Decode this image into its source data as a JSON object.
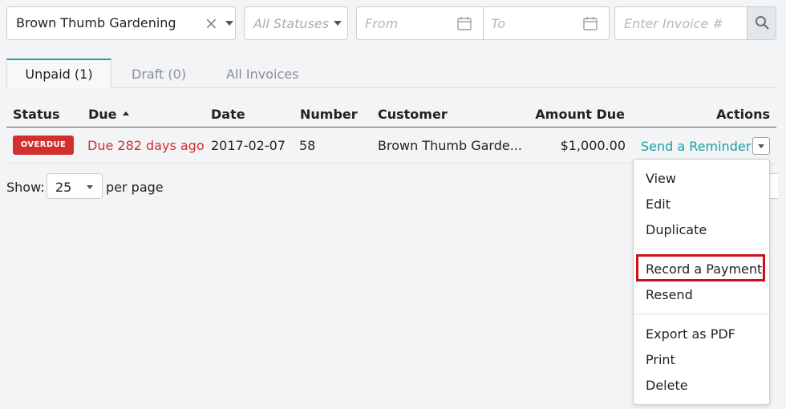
{
  "filters": {
    "customer_value": "Brown Thumb Gardening",
    "clear_glyph": "×",
    "status_placeholder": "All Statuses",
    "date_from_placeholder": "From",
    "date_to_placeholder": "To",
    "invoice_placeholder": "Enter Invoice #"
  },
  "tabs": [
    {
      "label": "Unpaid (1)",
      "active": true
    },
    {
      "label": "Draft (0)",
      "active": false
    },
    {
      "label": "All Invoices",
      "active": false
    }
  ],
  "table": {
    "columns": [
      "Status",
      "Due",
      "Date",
      "Number",
      "Customer",
      "Amount Due",
      "Actions"
    ],
    "sorted_column": "Due",
    "rows": [
      {
        "status": "OVERDUE",
        "due": "Due 282 days ago",
        "date": "2017-02-07",
        "number": "58",
        "customer": "Brown Thumb Garde...",
        "amount_due": "$1,000.00",
        "action": "Send a Reminder"
      }
    ]
  },
  "pagination": {
    "show_label": "Show:",
    "per_page_value": "25",
    "per_page_label": "per page"
  },
  "actions_menu": {
    "items": [
      "View",
      "Edit",
      "Duplicate",
      "Record a Payment",
      "Resend",
      "Export as PDF",
      "Print",
      "Delete"
    ],
    "highlighted": "Record a Payment"
  },
  "colors": {
    "accent": "#1a9ea6",
    "overdue": "#d1302f",
    "highlight_box": "#cc1016"
  }
}
